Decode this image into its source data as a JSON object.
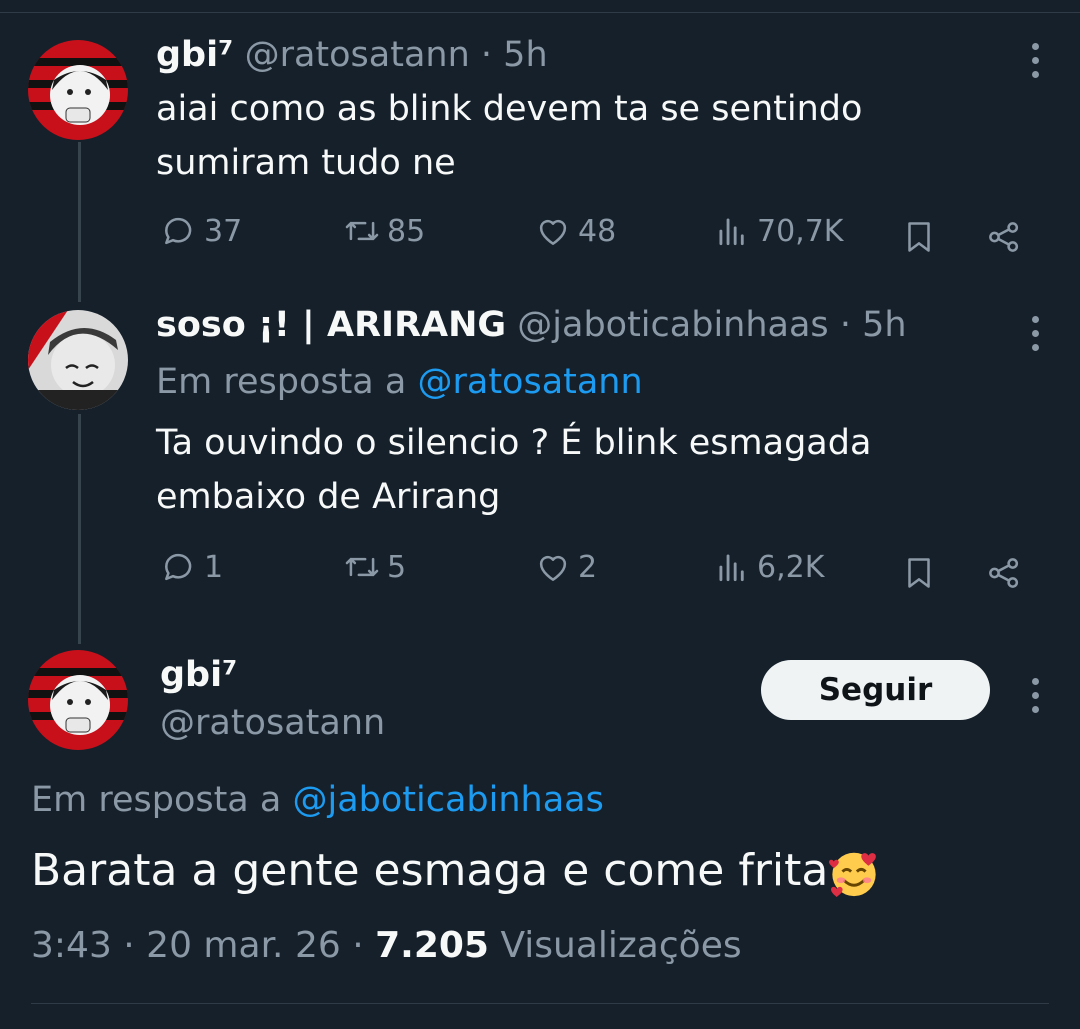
{
  "tweets": [
    {
      "name": "gbi⁷",
      "handle": "@ratosatann",
      "time": "· 5h",
      "text_line1": "aiai como as blink devem ta se sentindo",
      "text_line2": "sumiram tudo ne",
      "replies": "37",
      "retweets": "85",
      "likes": "48",
      "views": "70,7K"
    },
    {
      "name": "soso ¡! | ARIRANG",
      "handle": "@jaboticabinhaas",
      "time": "· 5h",
      "reply_prefix": "Em resposta a",
      "reply_to": "@ratosatann",
      "text_line1": "Ta ouvindo o silencio ? É blink esmagada",
      "text_line2": "embaixo de Arirang",
      "replies": "1",
      "retweets": "5",
      "likes": "2",
      "views": "6,2K"
    }
  ],
  "main": {
    "name": "gbi⁷",
    "handle": "@ratosatann",
    "follow_label": "Seguir",
    "reply_prefix": "Em resposta a",
    "reply_to": "@jaboticabinhaas",
    "text": "Barata a gente esmaga e come frita",
    "emoji": "smiling-face-with-hearts",
    "time": "3:43",
    "date": "· 20 mar. 26 ·",
    "views_count": "7.205",
    "views_label": "Visualizações"
  },
  "colors": {
    "background": "#15202b",
    "secondary_text": "#8b98a5",
    "link": "#1d9bf0",
    "button_bg": "#eff3f4"
  },
  "icons": [
    "reply-icon",
    "retweet-icon",
    "like-icon",
    "views-icon",
    "bookmark-icon",
    "share-icon",
    "more-icon"
  ]
}
